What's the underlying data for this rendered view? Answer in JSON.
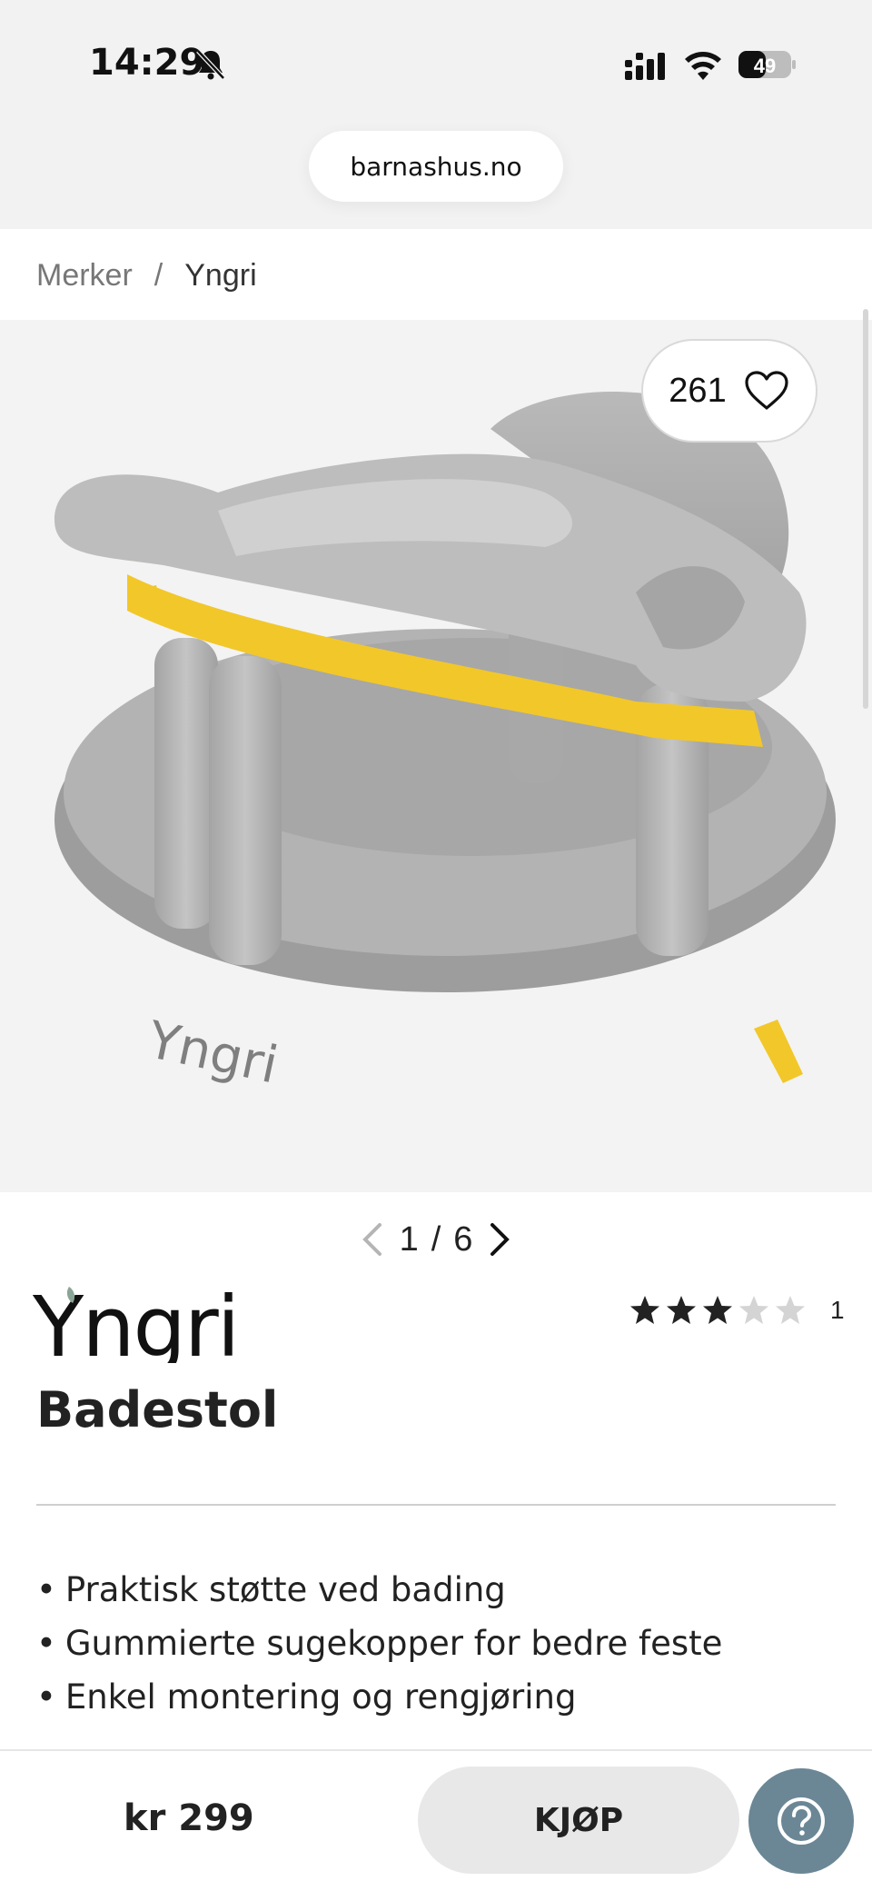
{
  "status_bar": {
    "time": "14:29",
    "battery": "49"
  },
  "browser": {
    "url": "barnashus.no"
  },
  "breadcrumb": {
    "items": [
      "Merker",
      "/",
      "Yngri"
    ]
  },
  "gallery": {
    "likes": "261",
    "current": "1",
    "separator": "/",
    "total": "6"
  },
  "product": {
    "brand": "Yngri",
    "title": "Badestol",
    "rating": 3,
    "rating_max": 5,
    "review_count": "1",
    "features": [
      "Praktisk støtte ved bading",
      "Gummierte sugekopper for bedre feste",
      "Enkel montering og rengjøring"
    ]
  },
  "footer": {
    "price": "kr 299",
    "buy_label": "KJØP"
  },
  "colors": {
    "accent_help": "#6b8796",
    "product_grey": "#a9a9a9",
    "product_yellow": "#f2c72a"
  }
}
